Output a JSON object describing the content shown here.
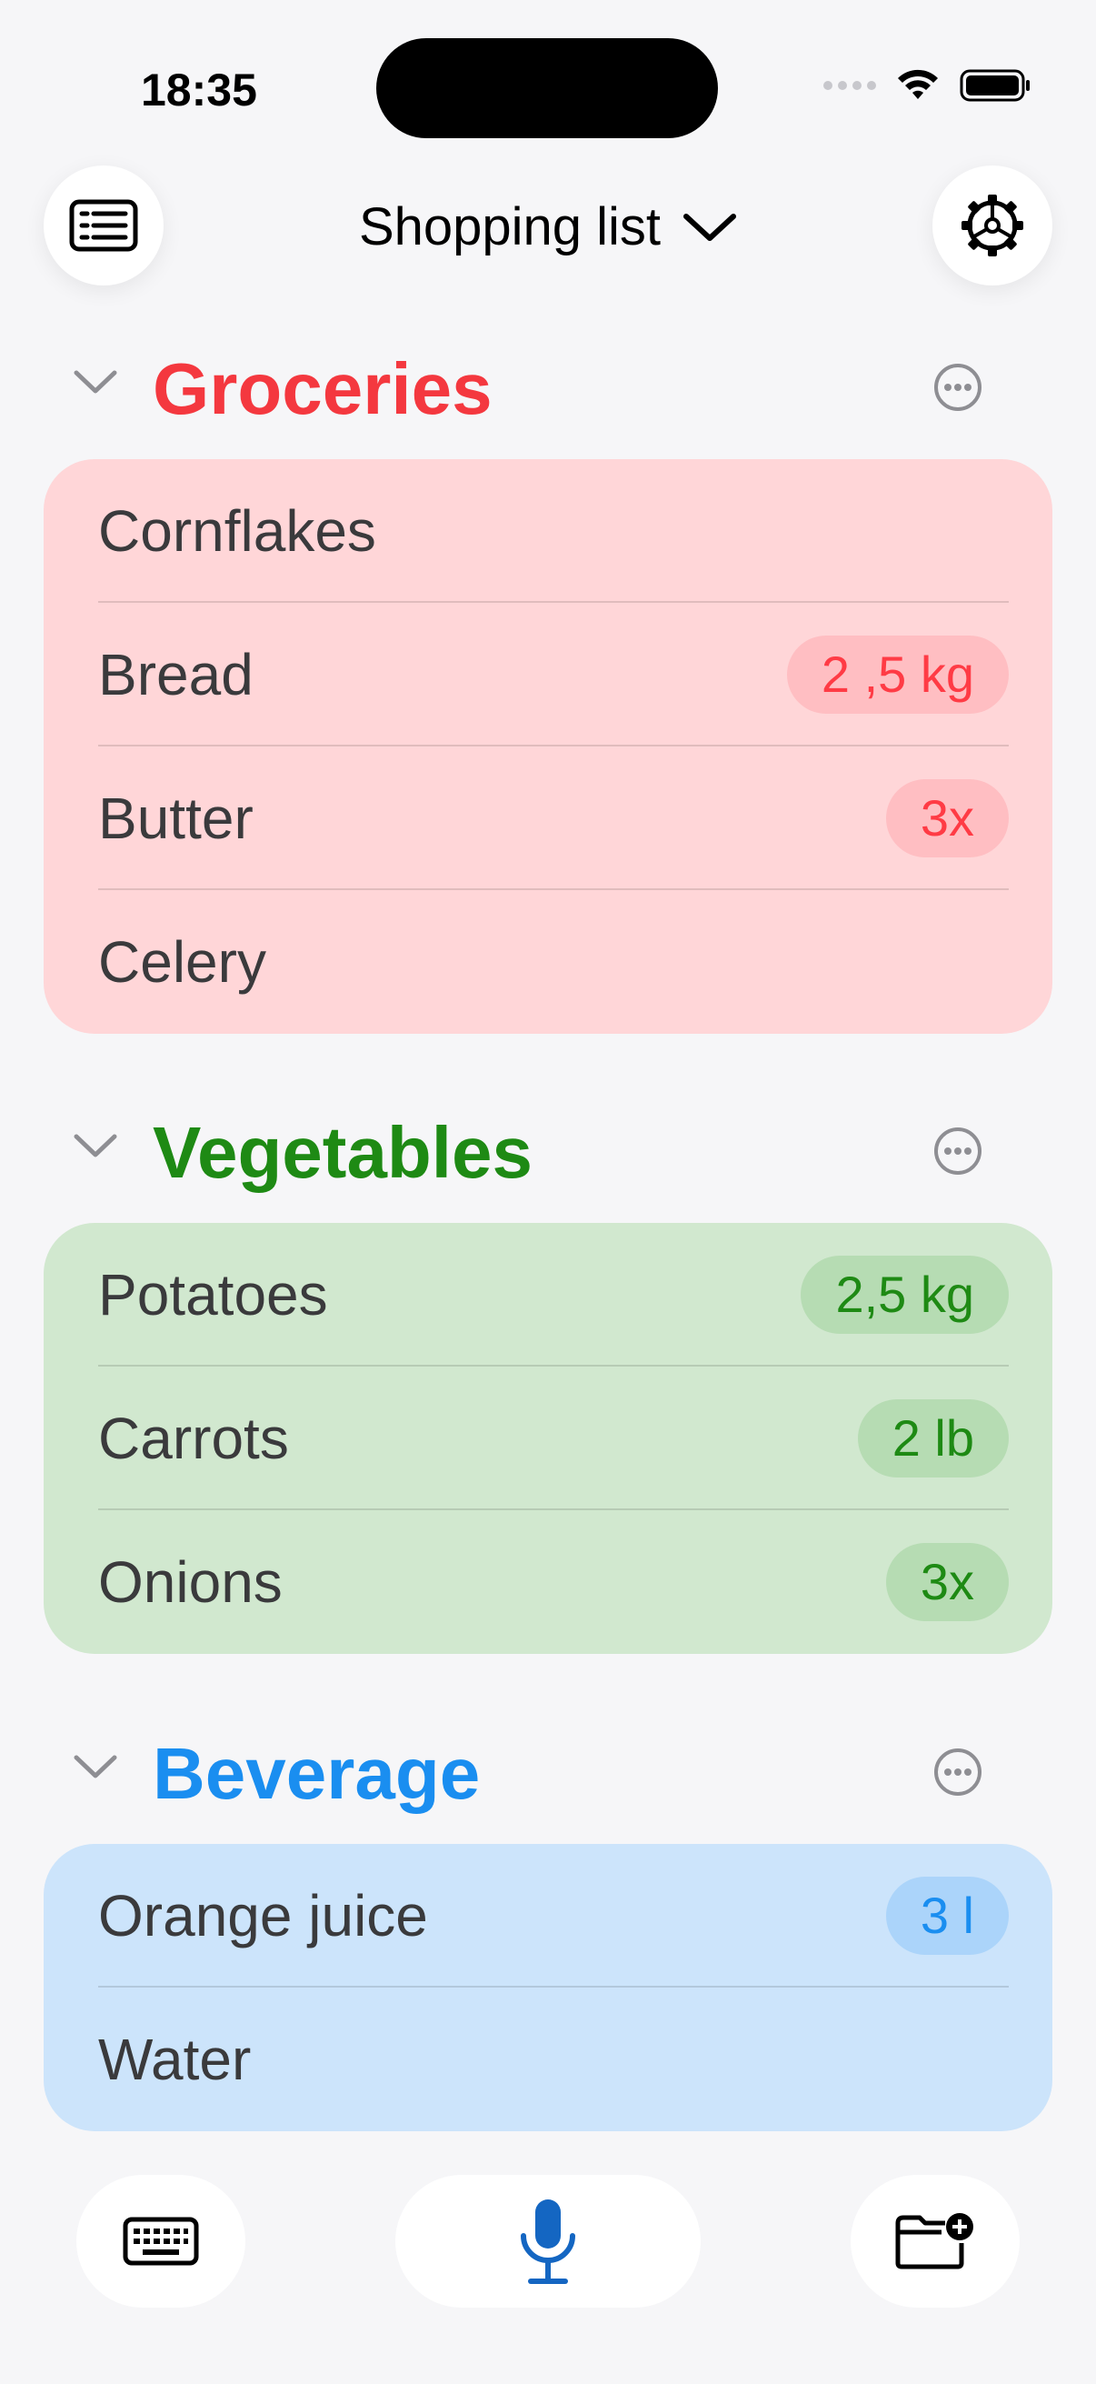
{
  "status_bar": {
    "time": "18:35"
  },
  "header": {
    "title": "Shopping list"
  },
  "sections": [
    {
      "title": "Groceries",
      "color": "#f4383f",
      "items": [
        {
          "name": "Cornflakes",
          "qty": ""
        },
        {
          "name": "Bread",
          "qty": "2 ,5 kg"
        },
        {
          "name": "Butter",
          "qty": "3x"
        },
        {
          "name": "Celery",
          "qty": ""
        }
      ]
    },
    {
      "title": "Vegetables",
      "color": "#1e8a14",
      "items": [
        {
          "name": "Potatoes",
          "qty": "2,5 kg"
        },
        {
          "name": "Carrots",
          "qty": "2 lb"
        },
        {
          "name": "Onions",
          "qty": "3x"
        }
      ]
    },
    {
      "title": "Beverage",
      "color": "#1a8ef0",
      "items": [
        {
          "name": "Orange juice",
          "qty": "3 l"
        },
        {
          "name": "Water",
          "qty": ""
        }
      ]
    }
  ],
  "icons": {
    "list": "list-icon",
    "settings": "gear-icon",
    "keyboard": "keyboard-icon",
    "mic": "microphone-icon",
    "add_folder": "folder-add-icon"
  }
}
